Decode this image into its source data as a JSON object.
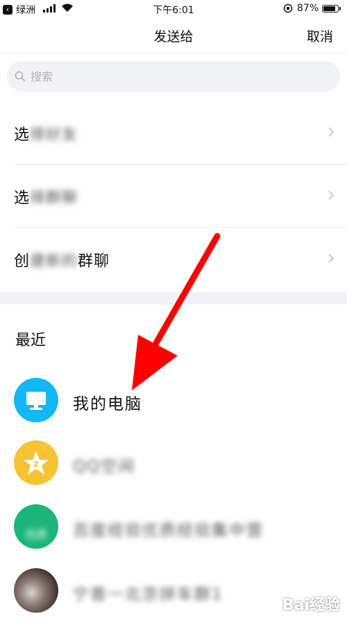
{
  "status_bar": {
    "back_app": "绿洲",
    "time": "下午6:01",
    "battery_percent": "87%",
    "battery_level": 0.87
  },
  "header": {
    "title": "发送给",
    "cancel_label": "取消"
  },
  "search": {
    "placeholder": "搜索"
  },
  "menu": [
    {
      "label": "选择好友"
    },
    {
      "label": "选择群聊"
    },
    {
      "label": "创建新的群聊"
    }
  ],
  "recent": {
    "title": "最近",
    "items": [
      {
        "name": "我的电脑",
        "avatar_color": "#12b7f5",
        "icon": "monitor-icon"
      },
      {
        "name": "QQ空间",
        "avatar_color": "#f7c233",
        "icon": "qzone-star-icon"
      },
      {
        "name": "百度经验优质经验集中营",
        "avatar_color": "#1ab57a",
        "icon": "group-avatar",
        "avatar_text": "优质"
      },
      {
        "name": "宁普一北京拼车群1",
        "avatar_color": "#5a4a44",
        "icon": "photo-avatar"
      }
    ]
  },
  "watermark": "Bai经验",
  "colors": {
    "accent_blue": "#12b7f5",
    "annotation_red": "#ff0000",
    "divider": "#eeeeee",
    "section_bg": "#f2f2f6"
  }
}
